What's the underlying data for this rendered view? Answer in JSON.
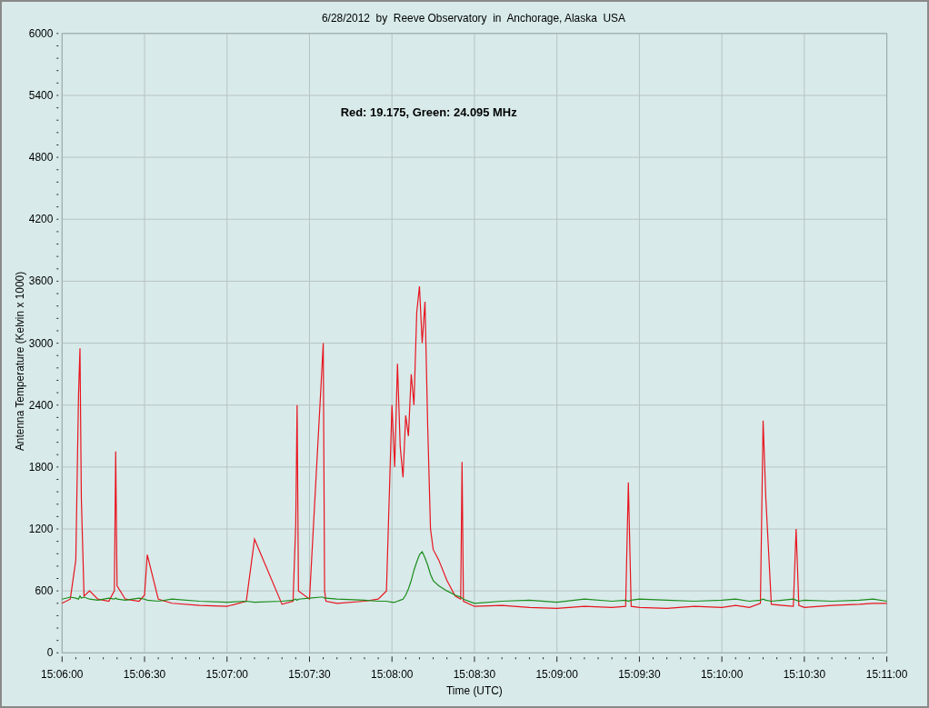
{
  "chart_data": {
    "type": "line",
    "title": "6/28/2012  by  Reeve Observatory  in  Anchorage, Alaska  USA",
    "xlabel": "Time (UTC)",
    "ylabel": "Antenna Temperature (Kelvin x 1000)",
    "x": [
      54360,
      54363,
      54365,
      54366,
      54366.5,
      54367,
      54368,
      54370,
      54373,
      54377,
      54379,
      54379.5,
      54380,
      54383,
      54388,
      54390,
      54391,
      54395,
      54400,
      54410,
      54420,
      54427,
      54430,
      54440,
      54444,
      54445,
      54445.5,
      54446,
      54450,
      54454,
      54455,
      54455.5,
      54456,
      54460,
      54470,
      54475,
      54478,
      54480,
      54481,
      54482,
      54483,
      54484,
      54485,
      54486,
      54487,
      54488,
      54489,
      54490,
      54491,
      54492,
      54493,
      54494,
      54495,
      54497,
      54500,
      54503,
      54505,
      54505.5,
      54506,
      54510,
      54520,
      54530,
      54540,
      54550,
      54560,
      54565,
      54566,
      54567,
      54570,
      54580,
      54590,
      54600,
      54605,
      54610,
      54614,
      54615,
      54616,
      54618,
      54622,
      54626,
      54627,
      54628,
      54630,
      54640,
      54650,
      54655,
      54660
    ],
    "series": [
      {
        "color": "#e8141e",
        "values": [
          480,
          520,
          900,
          2500,
          2950,
          1500,
          550,
          600,
          520,
          500,
          600,
          1950,
          650,
          520,
          500,
          560,
          950,
          520,
          480,
          460,
          450,
          500,
          1100,
          470,
          500,
          1250,
          2400,
          600,
          520,
          2500,
          3000,
          600,
          500,
          480,
          500,
          520,
          600,
          2400,
          1800,
          2800,
          2000,
          1700,
          2300,
          2100,
          2700,
          2400,
          3300,
          3550,
          3000,
          3400,
          2200,
          1200,
          1000,
          900,
          700,
          550,
          520,
          1850,
          500,
          450,
          460,
          440,
          430,
          450,
          440,
          450,
          1650,
          450,
          440,
          430,
          450,
          440,
          460,
          440,
          480,
          2250,
          1500,
          470,
          460,
          450,
          1200,
          460,
          440,
          460,
          470,
          480,
          480
        ]
      },
      {
        "color": "#1a8c1a",
        "values": [
          520,
          540,
          530,
          520,
          550,
          530,
          540,
          520,
          510,
          530,
          520,
          530,
          520,
          510,
          530,
          520,
          510,
          500,
          520,
          500,
          490,
          500,
          490,
          500,
          510,
          520,
          510,
          520,
          530,
          540,
          540,
          530,
          530,
          520,
          510,
          500,
          500,
          490,
          490,
          500,
          510,
          520,
          560,
          620,
          700,
          800,
          880,
          950,
          980,
          920,
          850,
          760,
          700,
          650,
          600,
          560,
          540,
          530,
          520,
          480,
          500,
          510,
          490,
          520,
          500,
          510,
          500,
          510,
          520,
          510,
          500,
          510,
          520,
          500,
          510,
          520,
          510,
          500,
          510,
          520,
          510,
          500,
          510,
          500,
          510,
          520,
          500
        ]
      }
    ],
    "grid": true,
    "xlim": [
      54360,
      54660
    ],
    "ylim": [
      0,
      6000
    ],
    "xticks": [
      {
        "value": 54360,
        "label": "15:06:00"
      },
      {
        "value": 54390,
        "label": "15:06:30"
      },
      {
        "value": 54420,
        "label": "15:07:00"
      },
      {
        "value": 54450,
        "label": "15:07:30"
      },
      {
        "value": 54480,
        "label": "15:08:00"
      },
      {
        "value": 54510,
        "label": "15:08:30"
      },
      {
        "value": 54540,
        "label": "15:09:00"
      },
      {
        "value": 54570,
        "label": "15:09:30"
      },
      {
        "value": 54600,
        "label": "15:10:00"
      },
      {
        "value": 54630,
        "label": "15:10:30"
      },
      {
        "value": 54660,
        "label": "15:11:00"
      }
    ],
    "yticks": [
      0,
      600,
      1200,
      1800,
      2400,
      3000,
      3600,
      4200,
      4800,
      5400,
      6000
    ],
    "annotations": [
      {
        "text": "Red: 19.175, Green: 24.095 MHz"
      }
    ]
  }
}
